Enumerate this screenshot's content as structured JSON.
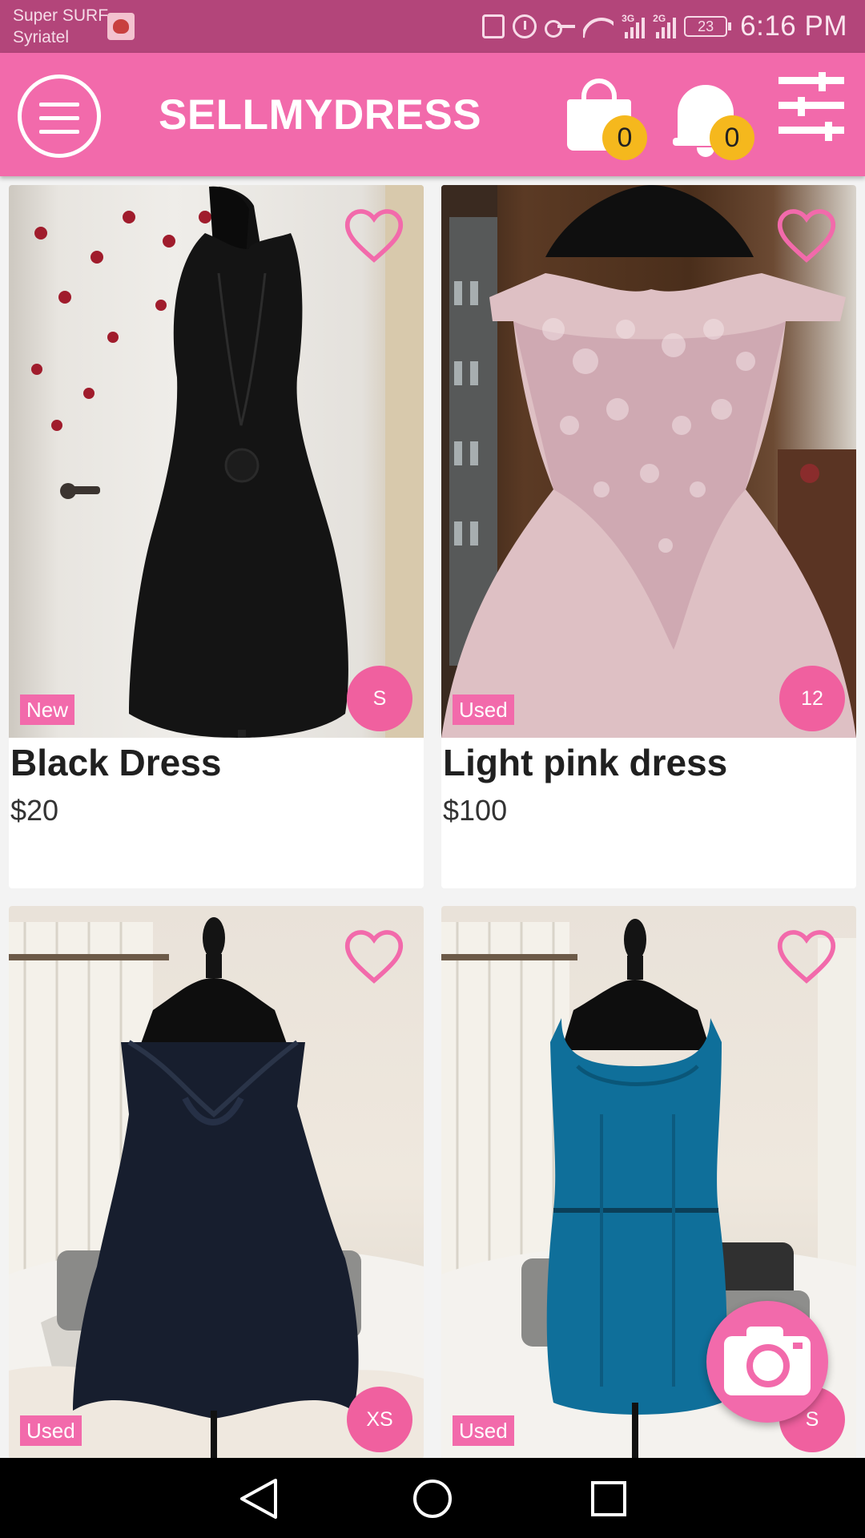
{
  "status_bar": {
    "carrier_line1": "Super SURF",
    "carrier_line2": "Syriatel",
    "net_3g": "3G",
    "net_2g": "2G",
    "battery": "23",
    "time": "6:16 PM"
  },
  "app_bar": {
    "title": "SELLMYDRESS",
    "cart_count": "0",
    "notification_count": "0"
  },
  "listings": [
    {
      "title": "Black Dress",
      "price": "$20",
      "condition": "New",
      "size": "S"
    },
    {
      "title": "Light pink dress",
      "price": "$100",
      "condition": "Used",
      "size": "12"
    },
    {
      "title": "",
      "price": "",
      "condition": "Used",
      "size": "XS"
    },
    {
      "title": "",
      "price": "",
      "condition": "Used",
      "size": "S"
    }
  ],
  "colors": {
    "brand_pink": "#f26aab",
    "status_bar": "#b3457a",
    "badge_yellow": "#f5b81d"
  },
  "icons": [
    "menu-icon",
    "shopping-bag-icon",
    "bell-icon",
    "filter-sliders-icon",
    "heart-icon",
    "camera-icon",
    "back-icon",
    "home-icon",
    "recents-icon"
  ]
}
